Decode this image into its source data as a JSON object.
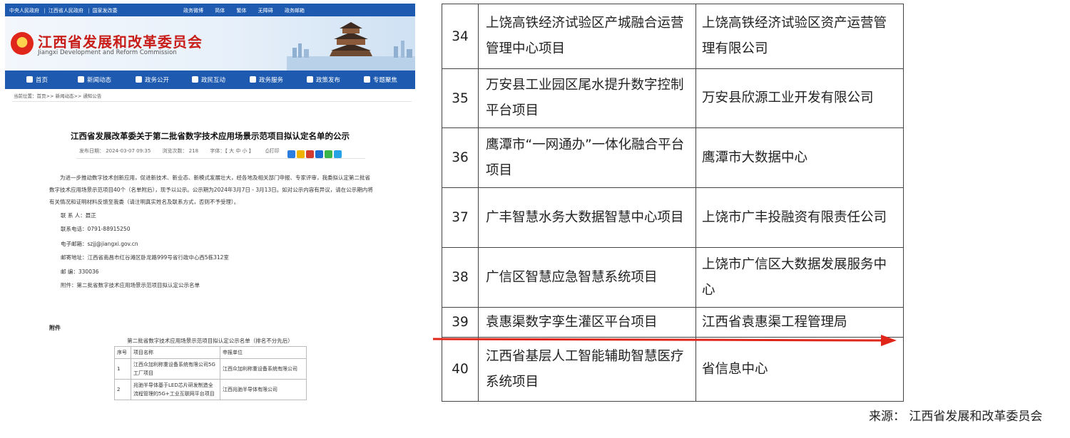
{
  "left": {
    "topbar_links": [
      "中央人民政府",
      "|",
      "江西省人民政府",
      "|",
      "国家发改委"
    ],
    "topbar_right": [
      "政务微博",
      "简体",
      "繁体",
      "无障碍",
      "政务邮箱"
    ],
    "site_name": "江西省发展和改革委员会",
    "site_name_en": "Jiangxi Development and Reform Commission",
    "nav": [
      "首页",
      "新闻动态",
      "政务公开",
      "政民互动",
      "政务服务",
      "政策发布",
      "专题聚焦"
    ],
    "breadcrumb": "当前位置：首页>> 新闻动态>> 通知公告",
    "article_title": "江西省发展改革委关于第二批省数字技术应用场景示范项目拟认定名单的公示",
    "meta": {
      "date": "发布日期： 2024-03-07 09:35",
      "views": "浏览次数： 218",
      "font_size": "字体：【 大 中 小 】",
      "print": "打印"
    },
    "body_paragraph": "为进一步推动数字技术创新应用，促进新技术、新业态、新模式发展壮大，经各地及相关部门申报、专家评审，我委拟认定第二批省数字技术应用场景示范项目40个（名单附后），现予以公示。公示期为2024年3月7日 - 3月13日。如对公示内容有异议，请在公示期内将有关情况和证明材料反馈至我委（请注明真实姓名及联系方式，否则不予受理）。",
    "contacts": [
      "联 系 人：聂正",
      "联系电话：0791-88915250",
      "电子邮箱：szjj@jiangxi.gov.cn",
      "邮寄地址：江西省南昌市红谷滩区卧龙路999号省行政中心西5栋312室",
      "邮    编：330036",
      "附件：第二批省数字技术应用场景示范项目拟认定公示名单"
    ],
    "annex_label": "附件",
    "annex_title": "第二批省数字技术应用场景示范项目拟认定公示名单（排名不分先后）",
    "table_header": [
      "序号",
      "项目名称",
      "申报单位"
    ],
    "table_rows": [
      {
        "no": "1",
        "project": "江西众加利称重设备系统有限公司5G工厂项目",
        "unit": "江西众加利称重设备系统有限公司"
      },
      {
        "no": "2",
        "project": "兆驰半导体基于LED芯片研发制造全流程管理的5G+工业互联网平台项目",
        "unit": "江西兆驰半导体有限公司"
      }
    ]
  },
  "right": {
    "rows": [
      {
        "no": "34",
        "project": "上饶高铁经济试验区产城融合运营管理中心项目",
        "unit": "上饶高铁经济试验区资产运营管理有限公司"
      },
      {
        "no": "35",
        "project": "万安县工业园区尾水提升数字控制平台项目",
        "unit": "万安县欣源工业开发有限公司"
      },
      {
        "no": "36",
        "project": "鹰潭市“一网通办”一体化融合平台项目",
        "unit": "鹰潭市大数据中心"
      },
      {
        "no": "37",
        "project": "广丰智慧水务大数据智慧中心项目",
        "unit": "上饶市广丰投融资有限责任公司"
      },
      {
        "no": "38",
        "project": "广信区智慧应急智慧系统项目",
        "unit": "上饶市广信区大数据发展服务中心"
      },
      {
        "no": "39",
        "project": "袁惠渠数字孪生灌区平台项目",
        "unit": "江西省袁惠渠工程管理局"
      },
      {
        "no": "40",
        "project": "江西省基层人工智能辅助智慧医疗系统项目",
        "unit": "省信息中心"
      }
    ],
    "source": "来源： 江西省发展和改革委员会"
  },
  "colors": {
    "site_blue": "#1e5bb0",
    "title_red": "#c81d18",
    "arrow_red": "#e0261b"
  }
}
